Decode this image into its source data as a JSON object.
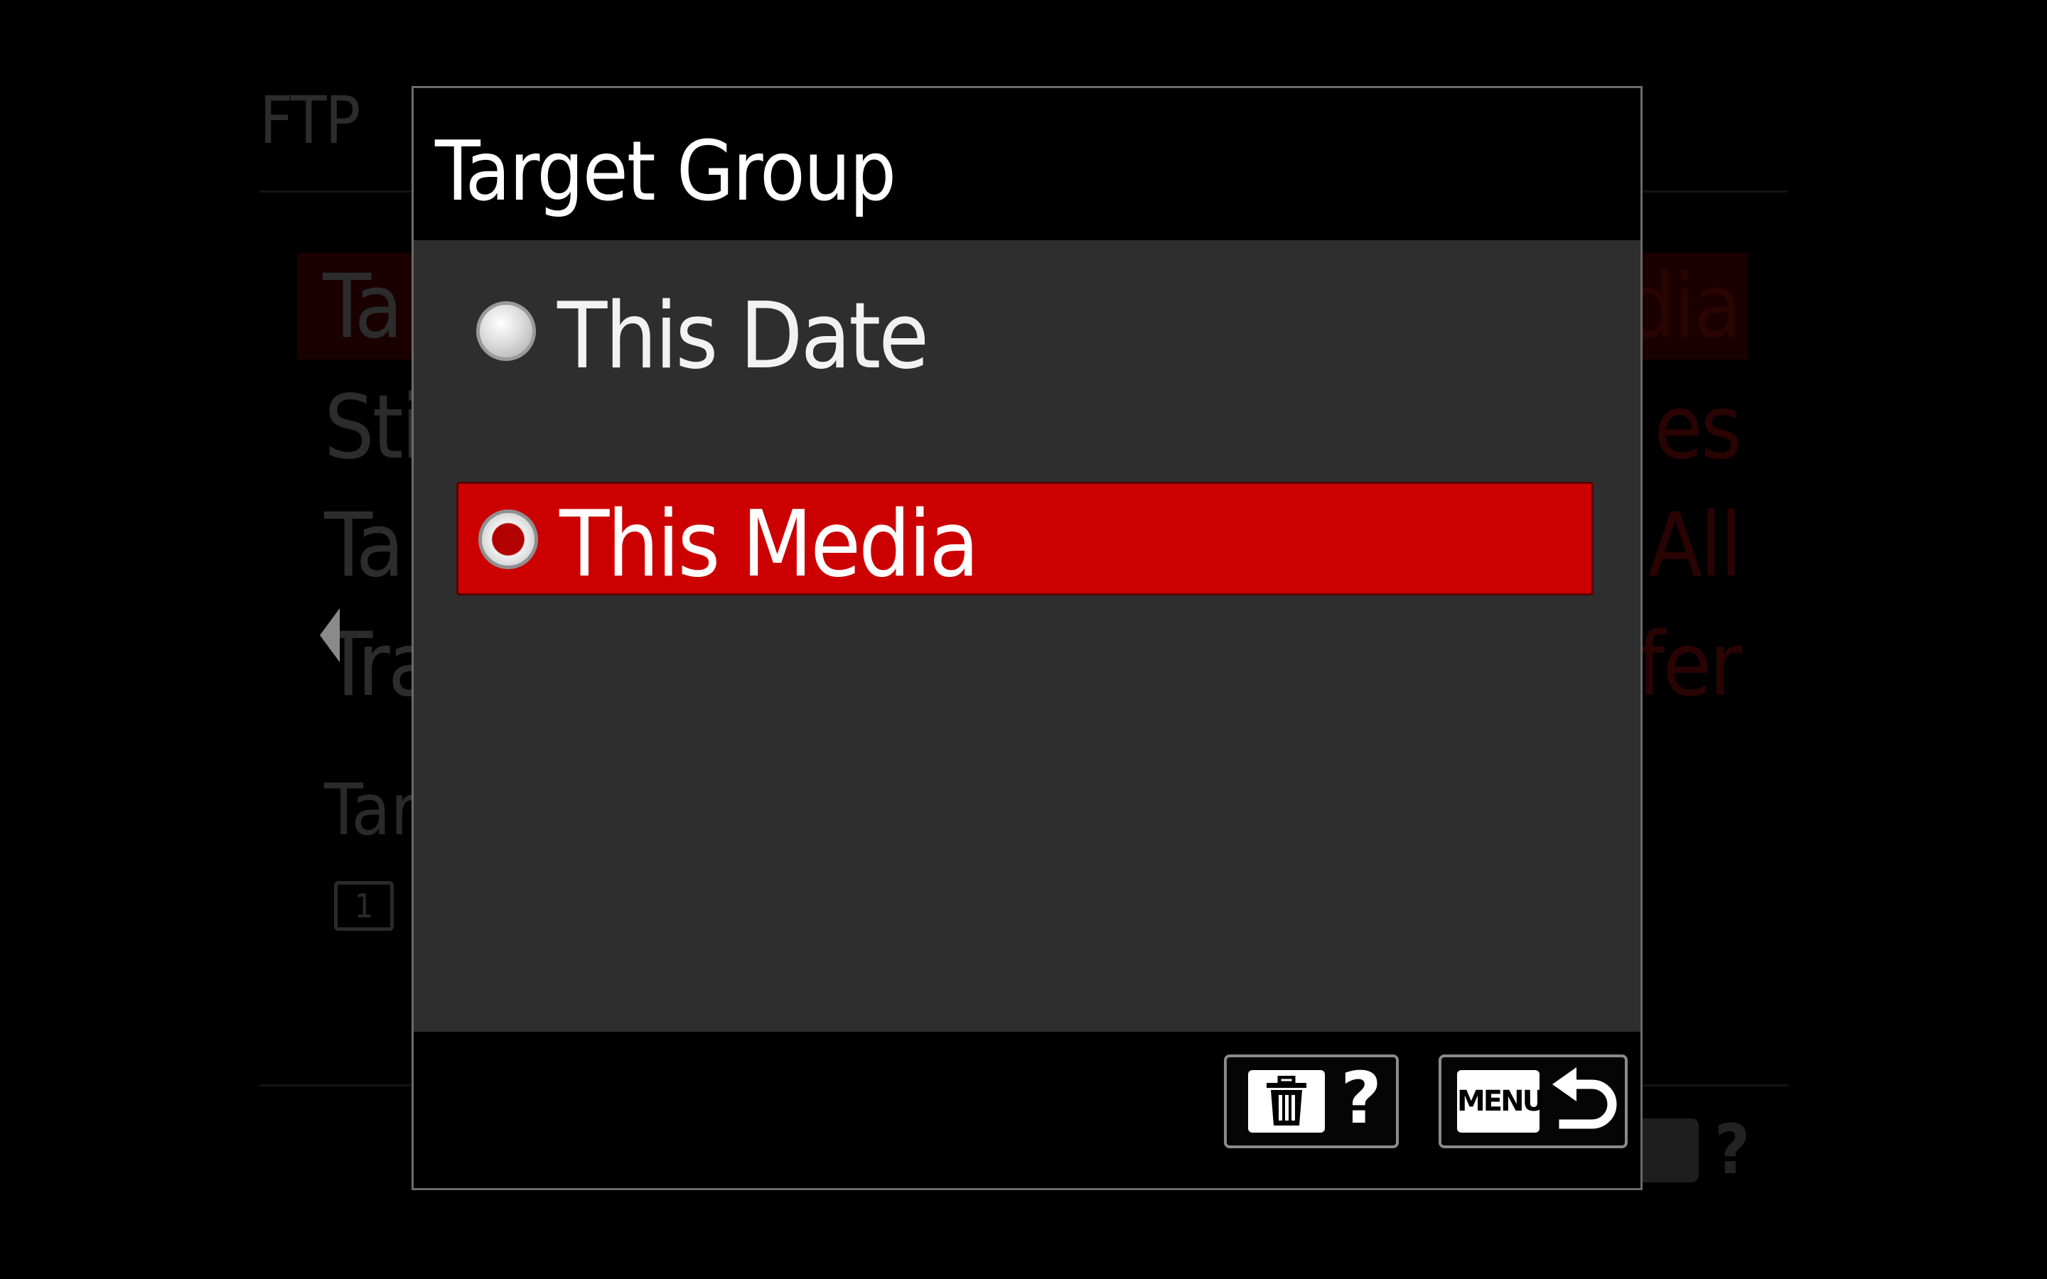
{
  "background_menu": {
    "header": "FTP",
    "rows": [
      {
        "label": "Ta",
        "value": "dia",
        "selected": true
      },
      {
        "label": "Sti",
        "value": "es",
        "selected": false
      },
      {
        "label": "Ta",
        "value": "All",
        "selected": false
      },
      {
        "label": "Tra",
        "value": "fer",
        "selected": false
      }
    ],
    "info_text": "Tar",
    "media_icon_text": "1",
    "footer_help": "?"
  },
  "dialog": {
    "title": "Target Group",
    "options": [
      {
        "label": "This Date",
        "selected": false
      },
      {
        "label": "This Media",
        "selected": true
      }
    ],
    "footer": {
      "help_label": "?",
      "menu_label": "MENU"
    }
  },
  "colors": {
    "background": "#000000",
    "dialog_body": "#2e2e2e",
    "selection": "#cc0000",
    "text": "#ffffff",
    "border": "#6a6a6a"
  },
  "icons": {
    "delete": "trash-icon",
    "help": "question-icon",
    "menu": "menu-key-icon",
    "back": "return-arrow-icon",
    "radio": "radio-button-icon",
    "nav_left": "left-arrow-icon"
  }
}
